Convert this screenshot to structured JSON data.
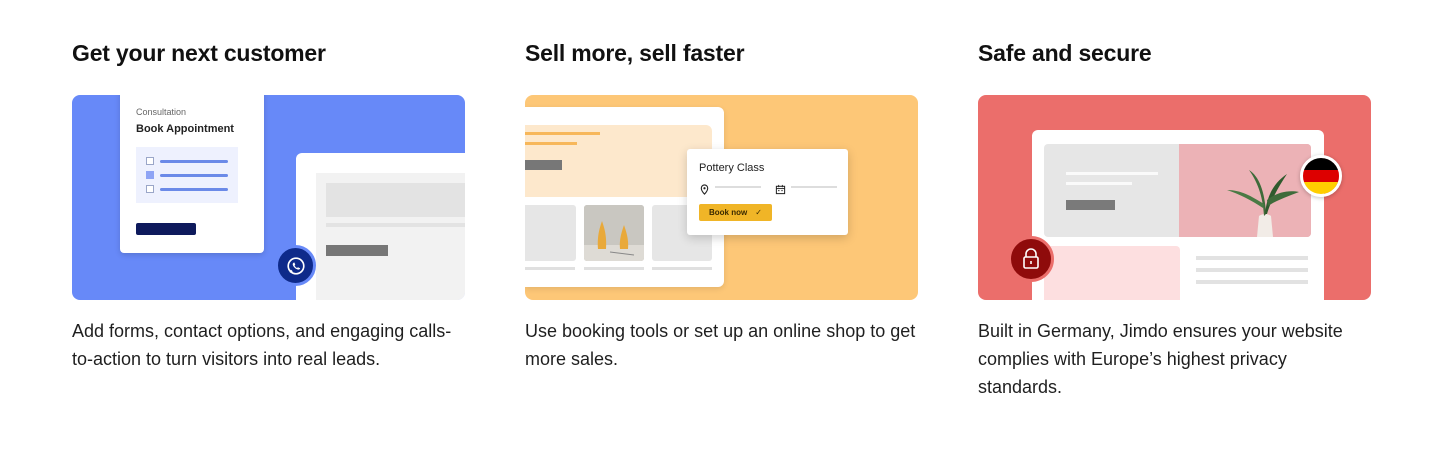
{
  "features": [
    {
      "title": "Get your next customer",
      "description": "Add forms, contact options, and engaging calls-to-action to turn visitors into real leads.",
      "card_color": "#6789f8",
      "illustration": {
        "form_subtitle": "Consultation",
        "form_title": "Book Appointment",
        "icon": "whatsapp-icon"
      }
    },
    {
      "title": "Sell more, sell faster",
      "description": "Use booking tools or set up an online shop to get more sales.",
      "card_color": "#fdc777",
      "illustration": {
        "popup_title": "Pottery Class",
        "button_label": "Book now",
        "button_check": "✓",
        "button_color": "#f0b527",
        "icons": [
          "location-pin-icon",
          "calendar-icon"
        ]
      }
    },
    {
      "title": "Safe and secure",
      "description": "Built in Germany, Jimdo ensures your website complies with Europe’s highest privacy standards.",
      "card_color": "#eb6e6b",
      "illustration": {
        "icons": [
          "germany-flag-icon",
          "lock-icon"
        ],
        "lock_color": "#8f0b0b"
      }
    }
  ]
}
